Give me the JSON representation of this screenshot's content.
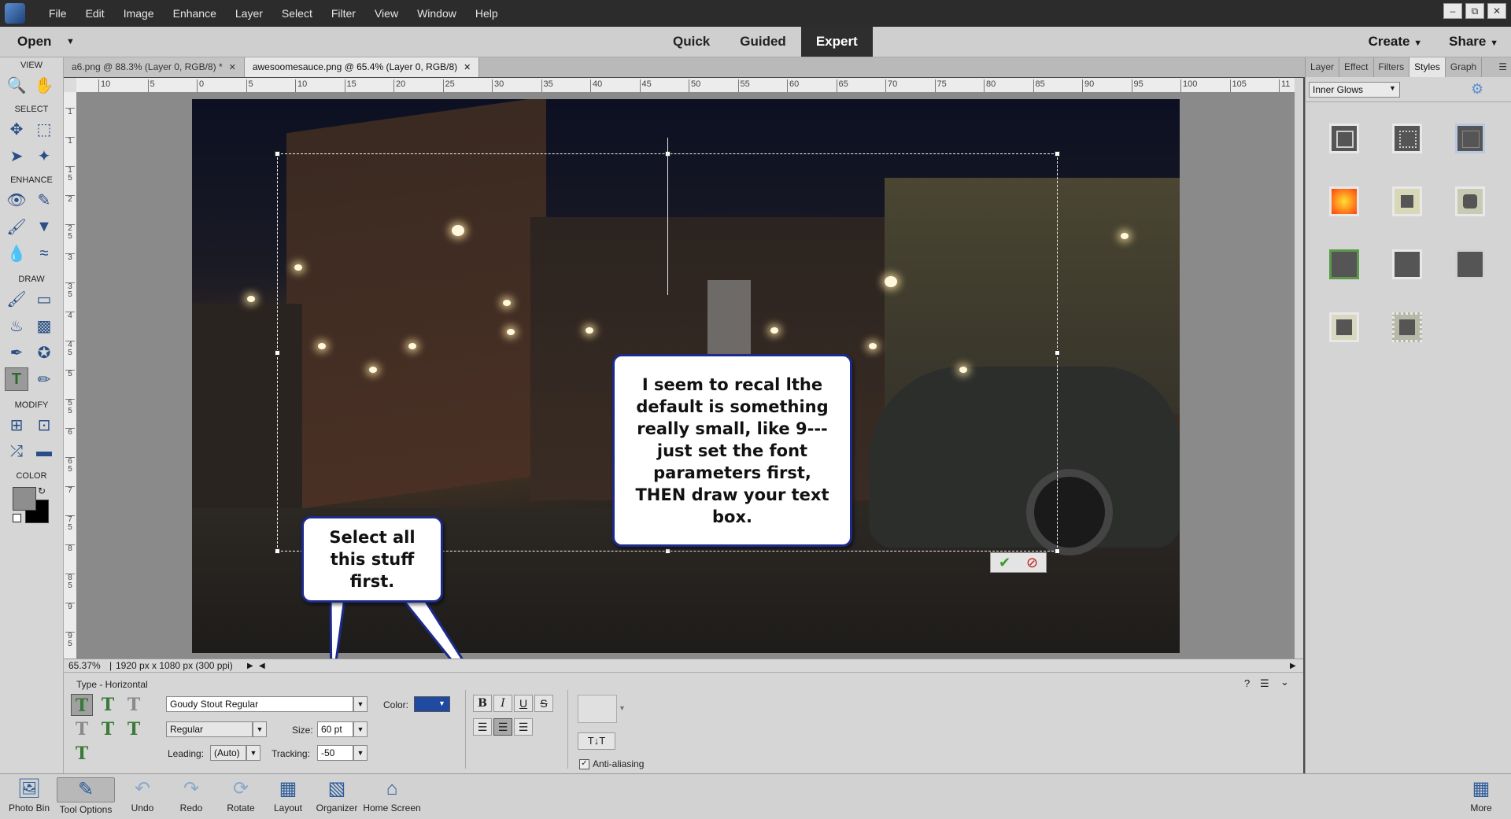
{
  "menubar": {
    "items": [
      "File",
      "Edit",
      "Image",
      "Enhance",
      "Layer",
      "Select",
      "Filter",
      "View",
      "Window",
      "Help"
    ],
    "window_buttons": [
      "–",
      "⧉",
      "✕"
    ]
  },
  "modebar": {
    "open": "Open",
    "modes": [
      "Quick",
      "Guided",
      "Expert"
    ],
    "create": "Create",
    "share": "Share"
  },
  "toolbar": {
    "sections": [
      "VIEW",
      "SELECT",
      "ENHANCE",
      "DRAW",
      "MODIFY",
      "COLOR"
    ]
  },
  "doc_tabs": [
    {
      "label": "a6.png @ 88.3% (Layer 0, RGB/8) *"
    },
    {
      "label": "awesoomesauce.png @ 65.4% (Layer 0, RGB/8)"
    }
  ],
  "ruler": {
    "h": [
      "10",
      "5",
      "0",
      "5",
      "10",
      "15",
      "20",
      "25",
      "30",
      "35",
      "40",
      "45",
      "50",
      "55",
      "60",
      "65",
      "70",
      "75",
      "80",
      "85",
      "90",
      "95",
      "100",
      "105",
      "11"
    ],
    "v": [
      "1",
      "1",
      "1 5",
      "2",
      "2 5",
      "3",
      "3 5",
      "4",
      "4 5",
      "5",
      "5 5",
      "6",
      "6 5",
      "7",
      "7 5",
      "8",
      "8 5",
      "9",
      "9 5"
    ]
  },
  "callouts": {
    "top": "I seem to recal lthe default is something really small, like 9---just set the font parameters first, THEN draw your text box.",
    "bottom": "Select all this stuff first."
  },
  "status": {
    "zoom": "65.37%",
    "info": "1920 px x 1080 px (300 ppi)"
  },
  "options": {
    "title": "Type - Horizontal",
    "font_family": "Goudy Stout Regular",
    "font_style": "Regular",
    "color_label": "Color:",
    "size_label": "Size:",
    "size": "60 pt",
    "leading_label": "Leading:",
    "leading": "(Auto)",
    "tracking_label": "Tracking:",
    "tracking": "-50",
    "antialias": "Anti-aliasing",
    "color_value": "#1f4aa0"
  },
  "taskbar": {
    "items": [
      "Photo Bin",
      "Tool Options",
      "Undo",
      "Redo",
      "Rotate",
      "Layout",
      "Organizer",
      "Home Screen"
    ],
    "more": "More"
  },
  "panel": {
    "tabs": [
      "Layer",
      "Effect",
      "Filters",
      "Styles",
      "Graph"
    ],
    "style_dropdown": "Inner Glows"
  }
}
